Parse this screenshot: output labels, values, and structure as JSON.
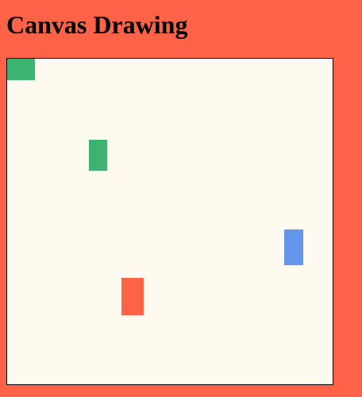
{
  "page": {
    "title": "Canvas Drawing",
    "background_color": "#ff6347"
  },
  "canvas": {
    "background_color": "#fffaf0",
    "border_color": "#000000",
    "shapes": [
      {
        "name": "green-rectangle-1",
        "kind": "rectangle",
        "color": "#3cb371"
      },
      {
        "name": "green-rectangle-2",
        "kind": "rectangle",
        "color": "#3cb371"
      },
      {
        "name": "blue-rectangle",
        "kind": "rectangle",
        "color": "#6495ed"
      },
      {
        "name": "red-rectangle",
        "kind": "rectangle",
        "color": "#ff6347"
      }
    ]
  }
}
